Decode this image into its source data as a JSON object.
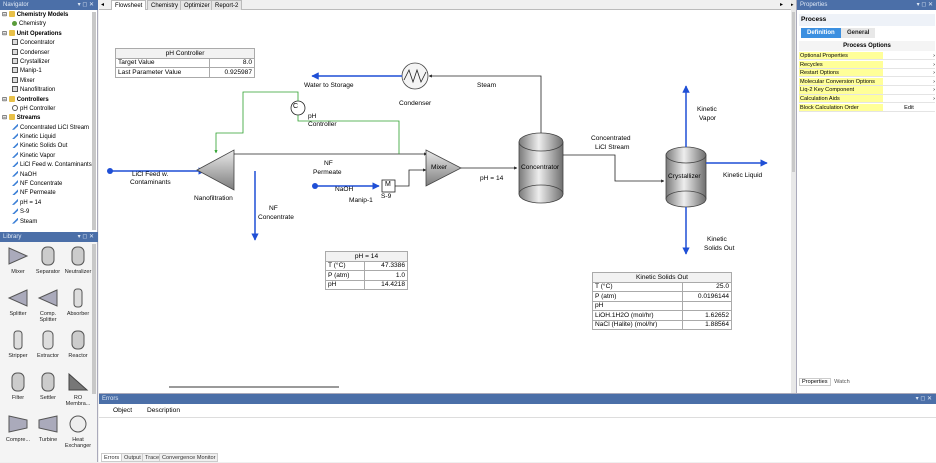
{
  "navigator": {
    "title": "Navigator",
    "items": [
      {
        "label": "Chemistry Models",
        "bold": true,
        "icon": "folder-icon",
        "indent": 0
      },
      {
        "label": "Chemistry",
        "bold": false,
        "icon": "chemistry-icon",
        "indent": 1
      },
      {
        "label": "Unit Operations",
        "bold": true,
        "icon": "folder-icon",
        "indent": 0
      },
      {
        "label": "Concentrator",
        "bold": false,
        "icon": "unit-icon",
        "indent": 1
      },
      {
        "label": "Condenser",
        "bold": false,
        "icon": "unit-icon",
        "indent": 1
      },
      {
        "label": "Crystallizer",
        "bold": false,
        "icon": "unit-icon",
        "indent": 1
      },
      {
        "label": "Manip-1",
        "bold": false,
        "icon": "unit-icon",
        "indent": 1
      },
      {
        "label": "Mixer",
        "bold": false,
        "icon": "unit-icon",
        "indent": 1
      },
      {
        "label": "Nanofiltration",
        "bold": false,
        "icon": "unit-icon",
        "indent": 1
      },
      {
        "label": "Controllers",
        "bold": true,
        "icon": "folder-icon",
        "indent": 0
      },
      {
        "label": "pH Controller",
        "bold": false,
        "icon": "controller-icon",
        "indent": 1
      },
      {
        "label": "Streams",
        "bold": true,
        "icon": "folder-icon",
        "indent": 0
      },
      {
        "label": "Concentrated LiCl Stream",
        "bold": false,
        "icon": "stream-icon",
        "indent": 1
      },
      {
        "label": "Kinetic Liquid",
        "bold": false,
        "icon": "stream-icon",
        "indent": 1
      },
      {
        "label": "Kinetic Solids Out",
        "bold": false,
        "icon": "stream-icon",
        "indent": 1
      },
      {
        "label": "Kinetic Vapor",
        "bold": false,
        "icon": "stream-icon",
        "indent": 1
      },
      {
        "label": "LiCl Feed w. Contaminants",
        "bold": false,
        "icon": "stream-icon",
        "indent": 1
      },
      {
        "label": "NaOH",
        "bold": false,
        "icon": "stream-icon",
        "indent": 1
      },
      {
        "label": "NF Concentrate",
        "bold": false,
        "icon": "stream-icon",
        "indent": 1
      },
      {
        "label": "NF Permeate",
        "bold": false,
        "icon": "stream-icon",
        "indent": 1
      },
      {
        "label": "pH = 14",
        "bold": false,
        "icon": "stream-icon",
        "indent": 1
      },
      {
        "label": "S-9",
        "bold": false,
        "icon": "stream-icon",
        "indent": 1
      },
      {
        "label": "Steam",
        "bold": false,
        "icon": "stream-icon",
        "indent": 1
      }
    ]
  },
  "library": {
    "title": "Library",
    "items": [
      {
        "label": "Mixer",
        "icon": "mixer-icon"
      },
      {
        "label": "Separator",
        "icon": "separator-icon"
      },
      {
        "label": "Neutralizer",
        "icon": "neutralizer-icon"
      },
      {
        "label": "Splitter",
        "icon": "splitter-icon"
      },
      {
        "label": "Comp. Splitter",
        "icon": "comp-splitter-icon"
      },
      {
        "label": "Absorber",
        "icon": "absorber-icon"
      },
      {
        "label": "Stripper",
        "icon": "stripper-icon"
      },
      {
        "label": "Extractor",
        "icon": "extractor-icon"
      },
      {
        "label": "Reactor",
        "icon": "reactor-icon"
      },
      {
        "label": "Filter",
        "icon": "filter-icon"
      },
      {
        "label": "Settler",
        "icon": "settler-icon"
      },
      {
        "label": "RO Membra...",
        "icon": "ro-membrane-icon"
      },
      {
        "label": "Compre...",
        "icon": "compressor-icon"
      },
      {
        "label": "Turbine",
        "icon": "turbine-icon"
      },
      {
        "label": "Heat Exchanger",
        "icon": "heat-exchanger-icon"
      }
    ]
  },
  "tabs": [
    "Flowsheet",
    "Chemistry",
    "Optimizer",
    "Report-2"
  ],
  "active_tab": "Flowsheet",
  "flowsheet": {
    "ph_controller_table": {
      "title": "pH Controller",
      "rows": [
        {
          "label": "Target Value",
          "value": "8.0"
        },
        {
          "label": "Last Parameter Value",
          "value": "0.925987"
        }
      ]
    },
    "ph14_table": {
      "title": "pH = 14",
      "rows": [
        {
          "label": "T (°C)",
          "value": "47.3386"
        },
        {
          "label": "P (atm)",
          "value": "1.0"
        },
        {
          "label": "pH",
          "value": "14.4218"
        }
      ]
    },
    "kinetic_solids_table": {
      "title": "Kinetic Solids Out",
      "rows": [
        {
          "label": "T (°C)",
          "value": "25.0"
        },
        {
          "label": "P (atm)",
          "value": "0.0196144"
        },
        {
          "label": "pH",
          "value": ""
        },
        {
          "label": "LiOH.1H2O (mol/hr)",
          "value": "1.62652"
        },
        {
          "label": "NaCl (Halite) (mol/hr)",
          "value": "1.88564"
        }
      ]
    },
    "labels": {
      "water_to_storage": "Water to Storage",
      "steam": "Steam",
      "condenser": "Condenser",
      "ph_controller_line1": "pH",
      "ph_controller_line2": "Controller",
      "controller_symbol": "C",
      "feed_line1": "LiCl Feed w.",
      "feed_line2": "Contaminants",
      "nanofiltration": "Nanofiltration",
      "nf_concentrate_line1": "NF",
      "nf_concentrate_line2": "Concentrate",
      "nf_permeate_line1": "NF",
      "nf_permeate_line2": "Permeate",
      "naoh": "NaOH",
      "manip_symbol": "M",
      "manip": "Manip-1",
      "s9": "S-9",
      "mixer": "Mixer",
      "ph14": "pH = 14",
      "concentrator": "Concentrator",
      "conc_stream_line1": "Concentrated",
      "conc_stream_line2": "LiCl Stream",
      "crystallizer": "Crystallizer",
      "kinetic_vapor_line1": "Kinetic",
      "kinetic_vapor_line2": "Vapor",
      "kinetic_liquid": "Kinetic Liquid",
      "kinetic_solids_line1": "Kinetic",
      "kinetic_solids_line2": "Solids Out"
    }
  },
  "properties": {
    "title": "Properties",
    "header": "Process",
    "tabs": [
      "Definition",
      "General"
    ],
    "active_tab": "Definition",
    "section": "Process Options",
    "rows": [
      {
        "label": "Optional Properties",
        "value": "",
        "arrow": "›"
      },
      {
        "label": "Recycles",
        "value": "",
        "arrow": "›"
      },
      {
        "label": "Restart Options",
        "value": "",
        "arrow": "›"
      },
      {
        "label": "Molecular Conversion Options",
        "value": "",
        "arrow": "›"
      },
      {
        "label": "Liq-2 Key Component",
        "value": "",
        "arrow": "›"
      },
      {
        "label": "Calculation Aids",
        "value": "",
        "arrow": "›"
      },
      {
        "label": "Block Calculation Order",
        "value": "Edit",
        "arrow": ""
      }
    ],
    "bottom_tabs": [
      "Properties",
      "Watch"
    ]
  },
  "errors": {
    "title": "Errors",
    "columns": [
      "Object",
      "Description"
    ],
    "tabs": [
      "Errors",
      "Output",
      "Trace",
      "Convergence Monitor"
    ]
  },
  "colors": {
    "titlebar": "#4b6fa8",
    "stream": "#1f4fd6",
    "controller_line": "#2ca02c",
    "highlight": "#ffff99",
    "active_tab": "#3b8fe0"
  }
}
